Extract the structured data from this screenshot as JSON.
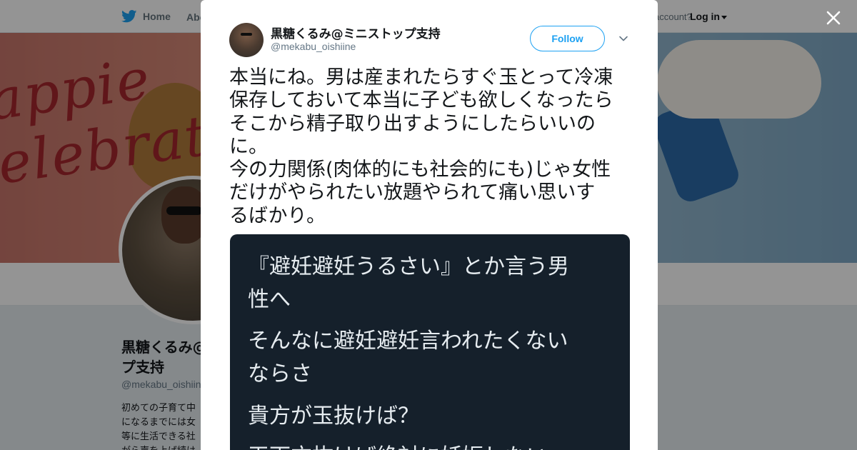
{
  "colors": {
    "brand_blue": "#1da1f2",
    "text_primary": "#14171a",
    "text_secondary": "#657786",
    "media_bg": "#15202b",
    "media_text": "#e6ecf0"
  },
  "topnav": {
    "home_label": "Home",
    "about_label": "Abo",
    "account_text": "account?",
    "login_label": "Log in"
  },
  "banner": {
    "text": "appie\nelebrat"
  },
  "profile": {
    "name": "黒糖くるみ@ミニストッ\nプ支持",
    "handle": "@mekabu_oishiin",
    "bio": "初めての子育て中\nになるまでには女\n等に生活できる社\nがら声を上げ続け"
  },
  "tweet": {
    "author_name": "黒糖くるみ@ミニストップ支持",
    "author_handle": "@mekabu_oishiine",
    "follow_label": "Follow",
    "text_lines": [
      "本当にね。男は産まれたらすぐ玉とって冷凍",
      "保存しておいて本当に子ども欲しくなったら",
      "そこから精子取り出すようにしたらいいの",
      "に。",
      "今の力関係(肉体的にも社会的にも)じゃ女性",
      "だけがやられたい放題やられて痛い思いす",
      "るばかり。"
    ],
    "media_lines": [
      "『避妊避妊うるさい』とか言う男",
      "性へ",
      "そんなに避妊避妊言われたくない",
      "ならさ",
      "貴方が玉抜けば？",
      "玉両方抜けば絶対に妊娠しない"
    ]
  },
  "icons": {
    "logo": "bird-icon",
    "close": "close-icon",
    "caret": "chevron-down-icon"
  }
}
